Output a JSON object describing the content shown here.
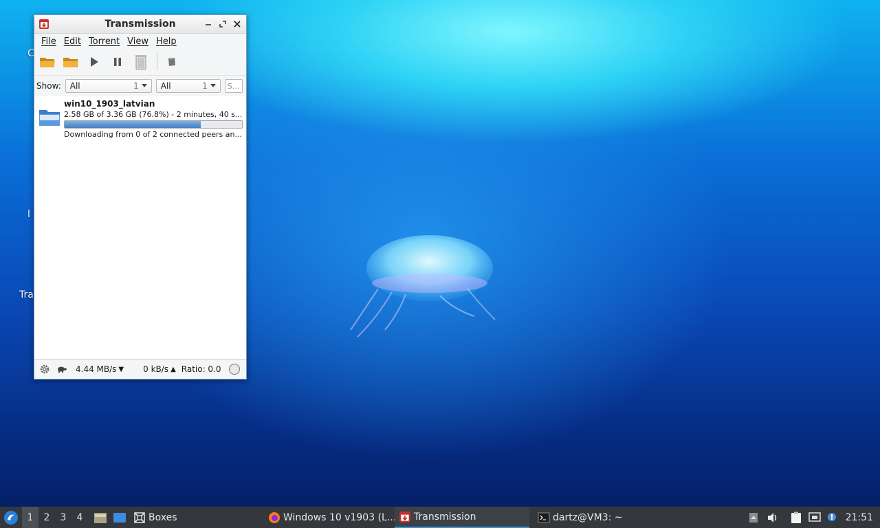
{
  "desktop": {
    "label_partial_1": "C",
    "label_partial_2": "l",
    "label_partial_3": "Tra"
  },
  "window": {
    "title": "Transmission",
    "menu": [
      "File",
      "Edit",
      "Torrent",
      "View",
      "Help"
    ],
    "filter": {
      "show_label": "Show:",
      "activity_value": "All",
      "activity_count": "1",
      "tracker_value": "All",
      "tracker_count": "1",
      "search_placeholder": "S..."
    },
    "torrents": [
      {
        "name": "win10_1903_latvian",
        "progress_text": "2.58 GB of 3.36 GB (76.8%) - 2 minutes, 40 s...",
        "progress_fraction": 0.768,
        "status_text": "Downloading from 0 of 2 connected peers an..."
      }
    ],
    "statusbar": {
      "download_speed": "4.44 MB/s",
      "upload_speed": "0 kB/s",
      "ratio": "Ratio: 0.0"
    }
  },
  "taskbar": {
    "workspaces": [
      "1",
      "2",
      "3",
      "4"
    ],
    "active_workspace": "1",
    "tasks": {
      "boxes": "Boxes",
      "firefox": "Windows 10 v1903 (L...",
      "transmission": "Transmission",
      "terminal": "dartz@VM3: ~"
    },
    "clock": "21:51",
    "accent": "#3d8fd8"
  }
}
